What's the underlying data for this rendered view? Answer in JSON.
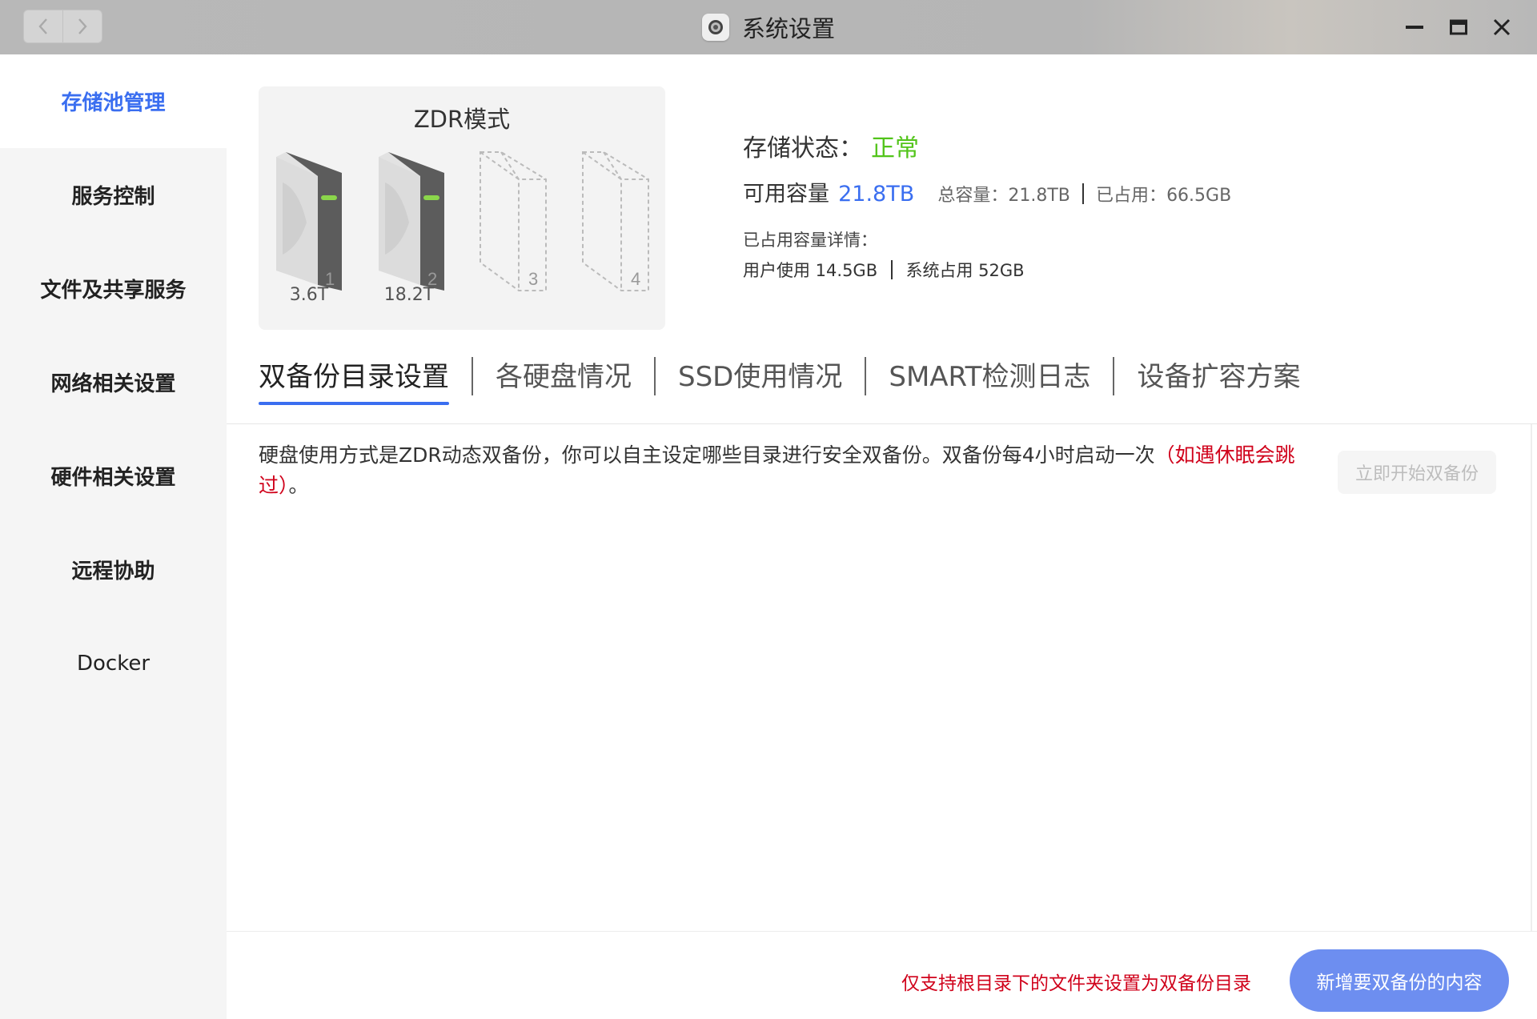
{
  "window": {
    "title": "系统设置",
    "icons": {
      "app": "settings-gear-icon",
      "back": "chevron-left-icon",
      "forward": "chevron-right-icon",
      "minimize": "minimize-icon",
      "maximize": "maximize-icon",
      "close": "close-icon"
    }
  },
  "sidebar": {
    "items": [
      {
        "label": "存储池管理",
        "active": true
      },
      {
        "label": "服务控制"
      },
      {
        "label": "文件及共享服务"
      },
      {
        "label": "网络相关设置"
      },
      {
        "label": "硬件相关设置"
      },
      {
        "label": "远程协助"
      },
      {
        "label": "Docker"
      }
    ]
  },
  "storage": {
    "mode": "ZDR模式",
    "drives": [
      {
        "slot": "1",
        "size": "3.6T",
        "present": true
      },
      {
        "slot": "2",
        "size": "18.2T",
        "present": true
      },
      {
        "slot": "3",
        "present": false
      },
      {
        "slot": "4",
        "present": false
      }
    ],
    "status_label": "存储状态：",
    "status_value": "正常",
    "available_label": "可用容量",
    "available_value": "21.8TB",
    "total_label": "总容量：",
    "total_value": "21.8TB",
    "used_label": "已占用：",
    "used_value": "66.5GB",
    "detail_label": "已占用容量详情：",
    "user_usage": "用户使用 14.5GB",
    "system_usage": "系统占用 52GB"
  },
  "colors": {
    "accent": "#3a6ef0",
    "ok": "#52c41a",
    "warn": "#d0021b",
    "button": "#6d8ef0"
  },
  "tabs": [
    {
      "label": "双备份目录设置",
      "active": true
    },
    {
      "label": "各硬盘情况"
    },
    {
      "label": "SSD使用情况"
    },
    {
      "label": "SMART检测日志"
    },
    {
      "label": "设备扩容方案"
    }
  ],
  "content": {
    "description": "硬盘使用方式是ZDR动态双备份，你可以自主设定哪些目录进行安全双备份。双备份每4小时启动一次",
    "description_warn": "（如遇休眠会跳过）",
    "description_end": "。",
    "start_button": "立即开始双备份",
    "footer_note": "仅支持根目录下的文件夹设置为双备份目录",
    "add_button": "新增要双备份的内容"
  }
}
